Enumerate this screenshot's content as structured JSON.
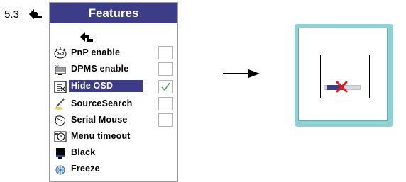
{
  "section": {
    "number": "5.3"
  },
  "menu": {
    "title": "Features",
    "items": [
      {
        "label": "PnP enable",
        "icon": "pnp-icon",
        "checkbox": true,
        "checked": false,
        "selected": false
      },
      {
        "label": "DPMS enable",
        "icon": "dpms-icon",
        "checkbox": true,
        "checked": false,
        "selected": false
      },
      {
        "label": "Hide OSD",
        "icon": "hide-osd-icon",
        "checkbox": true,
        "checked": true,
        "selected": true
      },
      {
        "label": "SourceSearch",
        "icon": "source-search-icon",
        "checkbox": true,
        "checked": false,
        "selected": false
      },
      {
        "label": "Serial Mouse",
        "icon": "serial-mouse-icon",
        "checkbox": true,
        "checked": false,
        "selected": false
      },
      {
        "label": "Menu timeout",
        "icon": "menu-timeout-icon",
        "checkbox": false,
        "checked": false,
        "selected": false
      },
      {
        "label": "Black",
        "icon": "black-icon",
        "checkbox": false,
        "checked": false,
        "selected": false
      },
      {
        "label": "Freeze",
        "icon": "freeze-icon",
        "checkbox": false,
        "checked": false,
        "selected": false
      }
    ]
  },
  "colors": {
    "header_bg": "#3d3c88",
    "selection_bg": "#3d3c88",
    "check_color": "#3aa84a",
    "osd_frame": "#8fd1d4",
    "x_mark": "#e01a1a"
  }
}
